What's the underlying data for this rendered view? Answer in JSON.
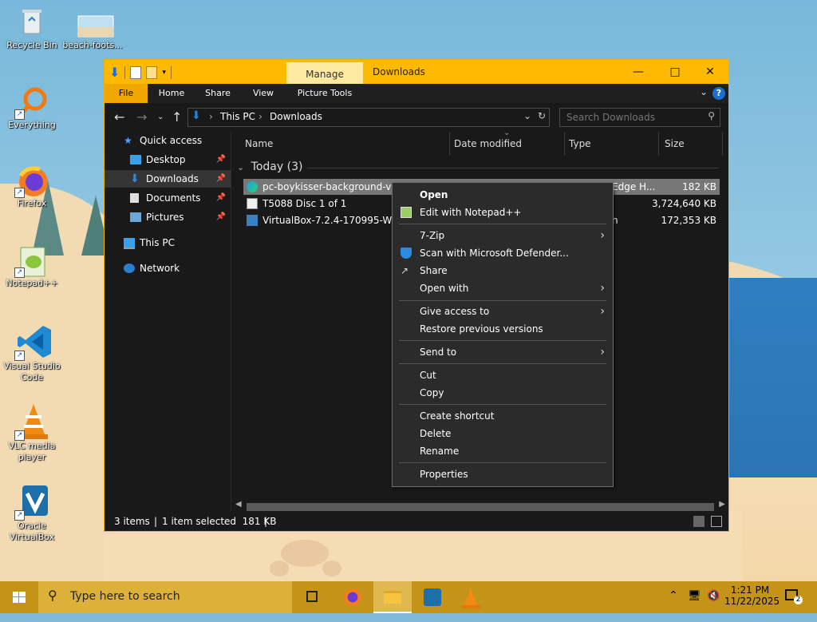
{
  "desktop": {
    "icons": [
      {
        "label": "Recycle Bin"
      },
      {
        "label": "beach-foots..."
      },
      {
        "label": "Everything"
      },
      {
        "label": "Firefox"
      },
      {
        "label": "Notepad++"
      },
      {
        "label": "Visual Studio Code"
      },
      {
        "label": "VLC media player"
      },
      {
        "label": "Oracle VirtualBox"
      }
    ]
  },
  "window": {
    "title": "Downloads",
    "context_tab": "Manage",
    "ribbon_tabs": [
      "File",
      "Home",
      "Share",
      "View",
      "Picture Tools"
    ],
    "breadcrumb": [
      "This PC",
      "Downloads"
    ],
    "search_placeholder": "Search Downloads",
    "nav": {
      "quick_access": "Quick access",
      "items": [
        "Desktop",
        "Downloads",
        "Documents",
        "Pictures"
      ],
      "this_pc": "This PC",
      "network": "Network"
    },
    "columns": [
      "Name",
      "Date modified",
      "Type",
      "Size"
    ],
    "group": "Today (3)",
    "files": [
      {
        "name": "pc-boykisser-background-v0-b",
        "type": "Edge H...",
        "size": "182 KB",
        "selected": true
      },
      {
        "name": "T5088 Disc 1 of 1",
        "type": "",
        "size": "3,724,640 KB",
        "selected": false
      },
      {
        "name": "VirtualBox-7.2.4-170995-Win",
        "type": "n",
        "size": "172,353 KB",
        "selected": false
      }
    ],
    "status": {
      "items": "3 items",
      "selected": "1 item selected  181 KB",
      "sep": "|"
    }
  },
  "context_menu": {
    "items": [
      {
        "label": "Open",
        "bold": true
      },
      {
        "label": "Edit with Notepad++"
      },
      {
        "label": "7-Zip",
        "submenu": true
      },
      {
        "label": "Scan with Microsoft Defender..."
      },
      {
        "label": "Share"
      },
      {
        "label": "Open with",
        "submenu": true
      },
      {
        "label": "Give access to",
        "submenu": true
      },
      {
        "label": "Restore previous versions"
      },
      {
        "label": "Send to",
        "submenu": true
      },
      {
        "label": "Cut"
      },
      {
        "label": "Copy"
      },
      {
        "label": "Create shortcut"
      },
      {
        "label": "Delete"
      },
      {
        "label": "Rename"
      },
      {
        "label": "Properties"
      }
    ]
  },
  "taskbar": {
    "search_placeholder": "Type here to search",
    "time": "1:21 PM",
    "date": "11/22/2025",
    "notification_count": "2"
  },
  "colors": {
    "accent": "#ffb900",
    "taskbar": "#c49418",
    "window_bg": "#191919"
  }
}
